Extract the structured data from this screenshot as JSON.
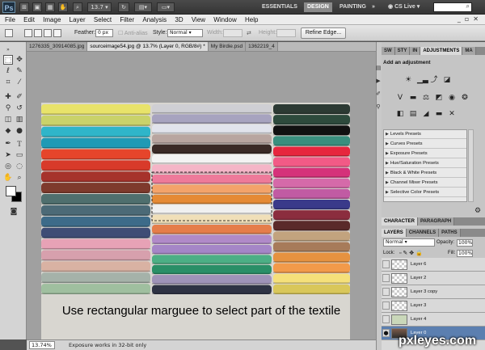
{
  "app": {
    "logo": "Ps",
    "zoom_dropdown": "13.7",
    "workspaces": [
      "ESSENTIALS",
      "DESIGN",
      "PAINTING"
    ],
    "active_workspace": "DESIGN",
    "cs_live": "CS Live",
    "more": "»"
  },
  "menus": [
    "File",
    "Edit",
    "Image",
    "Layer",
    "Select",
    "Filter",
    "Analysis",
    "3D",
    "View",
    "Window",
    "Help"
  ],
  "options": {
    "feather_label": "Feather:",
    "feather_value": "0 px",
    "antialias_label": "Anti-alias",
    "style_label": "Style:",
    "style_value": "Normal",
    "width_label": "Width:",
    "height_label": "Height:",
    "refine_edge": "Refine Edge..."
  },
  "doc_tabs": [
    "1276335_30914085.jpg",
    "sourceimage54.jpg @ 13.7% (Layer 0, RGB/8#) *",
    "My Birdie.psd",
    "1362219_4"
  ],
  "active_doc_tab": 1,
  "canvas": {
    "caption": "Use rectangular marguee to select part of the textile"
  },
  "status": {
    "zoom": "13.74%",
    "message": "Exposure works in 32-bit only"
  },
  "panels": {
    "top_tabs": [
      "SW",
      "STY",
      "IN",
      "ADJUSTMENTS",
      "MA"
    ],
    "active_top_tab": "ADJUSTMENTS",
    "adjust_title": "Add an adjustment",
    "presets": [
      "Levels Presets",
      "Curves Presets",
      "Exposure Presets",
      "Hue/Saturation Presets",
      "Black & White Presets",
      "Channel Mixer Presets",
      "Selective Color Presets"
    ],
    "char_tabs": [
      "CHARACTER",
      "PARAGRAPH"
    ],
    "layer_tabs": [
      "LAYERS",
      "CHANNELS",
      "PATHS"
    ],
    "blend_mode": "Normal",
    "opacity_label": "Opacity:",
    "opacity_value": "100%",
    "lock_label": "Lock:",
    "fill_label": "Fill:",
    "fill_value": "100%",
    "layers": [
      "Layer 6",
      "Layer 2",
      "Layer 3 copy",
      "Layer 3",
      "Layer 4",
      "Layer 0"
    ],
    "selected_layer": "Layer 0"
  },
  "watermark": "pxleyes.com",
  "colors": {
    "appbar": "#3d3d3d",
    "workspace": "#a0a0a0",
    "selected_layer": "#5b7fb0"
  }
}
